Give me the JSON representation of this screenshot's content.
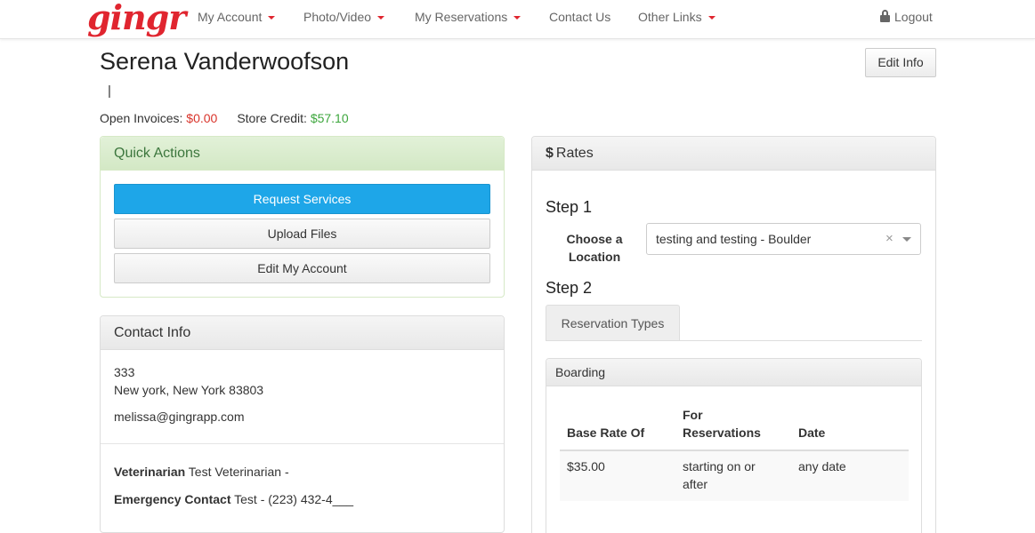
{
  "nav": {
    "logo": "gingr",
    "items": [
      "My Account",
      "Photo/Video",
      "My Reservations",
      "Contact Us",
      "Other Links"
    ],
    "logout": "Logout"
  },
  "client": {
    "name": "Serena Vanderwoofson",
    "pipe": "|",
    "edit_info": "Edit Info",
    "open_invoices_label": "Open Invoices:",
    "open_invoices_value": "$0.00",
    "store_credit_label": "Store Credit:",
    "store_credit_value": "$57.10"
  },
  "quick_actions": {
    "title": "Quick Actions",
    "buttons": [
      "Request Services",
      "Upload Files",
      "Edit My Account"
    ]
  },
  "contact": {
    "title": "Contact Info",
    "address_line1": "333",
    "address_line2": "New york, New York 83803",
    "email": "melissa@gingrapp.com",
    "vet_label": "Veterinarian",
    "vet_value": "Test Veterinarian -",
    "emergency_label": "Emergency Contact",
    "emergency_value": "Test - (223) 432-4___"
  },
  "rates": {
    "title": "Rates",
    "icon": "dollar-icon",
    "step1": "Step 1",
    "location_label_1": "Choose a",
    "location_label_2": "Location",
    "location_value": "testing and testing - Boulder",
    "clear_symbol": "×",
    "step2": "Step 2",
    "tab": "Reservation Types",
    "boarding": {
      "title": "Boarding",
      "headers": [
        "Base Rate Of",
        "For",
        "Reservations",
        "Date"
      ],
      "row": {
        "rate": "$35.00",
        "for_1": "starting on or",
        "for_2": "after",
        "date": "any date"
      }
    }
  },
  "colors": {
    "brand": "#e0252f",
    "primary_button": "#1ea6e8",
    "invoice": "#d9342b",
    "credit": "#3ca63c"
  }
}
